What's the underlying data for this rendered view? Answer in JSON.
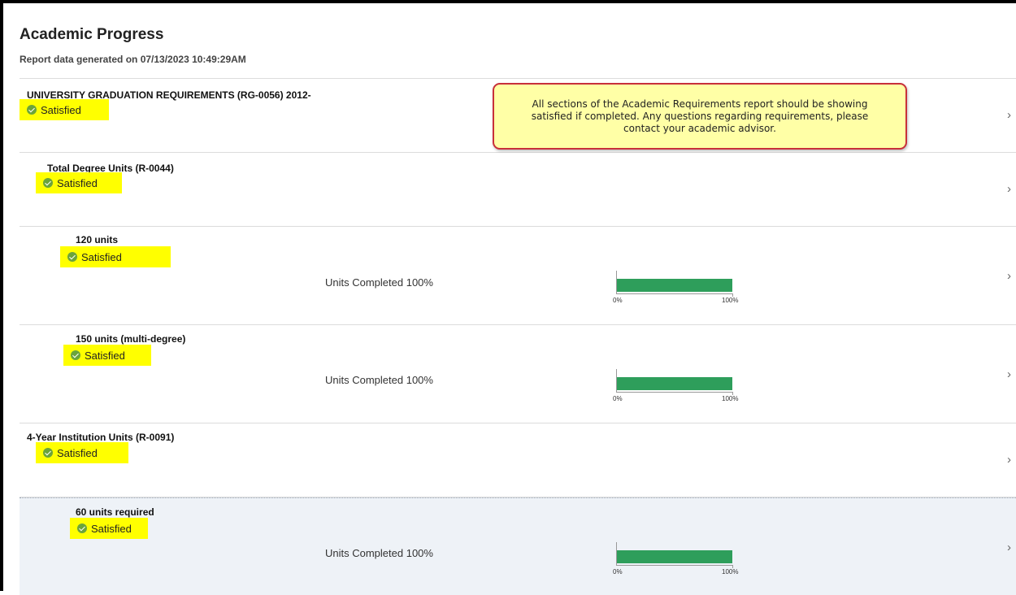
{
  "page": {
    "title": "Academic Progress",
    "report_date": "Report data generated on 07/13/2023 10:49:29AM"
  },
  "callout_text": "All sections of the Academic Requirements report should be showing satisfied if completed. Any questions regarding requirements, please contact your academic advisor.",
  "status_label": "Satisfied",
  "rows": [
    {
      "title": "UNIVERSITY GRADUATION REQUIREMENTS (RG-0056) 2012-",
      "status": "Satisfied"
    },
    {
      "title": "Total Degree Units (R-0044)",
      "status": "Satisfied"
    },
    {
      "title": "120 units",
      "status": "Satisfied",
      "progress_label": "Units Completed 100%",
      "progress": 1.0,
      "axis_min": "0%",
      "axis_max": "100%"
    },
    {
      "title": "150 units (multi-degree)",
      "status": "Satisfied",
      "progress_label": "Units Completed 100%",
      "progress": 1.0,
      "axis_min": "0%",
      "axis_max": "100%"
    },
    {
      "title": "4-Year Institution Units (R-0091)",
      "status": "Satisfied"
    },
    {
      "title": "60 units required",
      "status": "Satisfied",
      "progress_label": "Units Completed 100%",
      "progress": 1.0,
      "axis_min": "0%",
      "axis_max": "100%"
    }
  ],
  "icons": {
    "status": "check-circle-icon",
    "row_nav": "chevron-right-icon"
  },
  "colors": {
    "highlight": "#ffff00",
    "check": "#6ca43b",
    "progress_fill": "#2e9e5b",
    "callout_bg": "#ffffa6",
    "callout_border": "#c8303a"
  }
}
